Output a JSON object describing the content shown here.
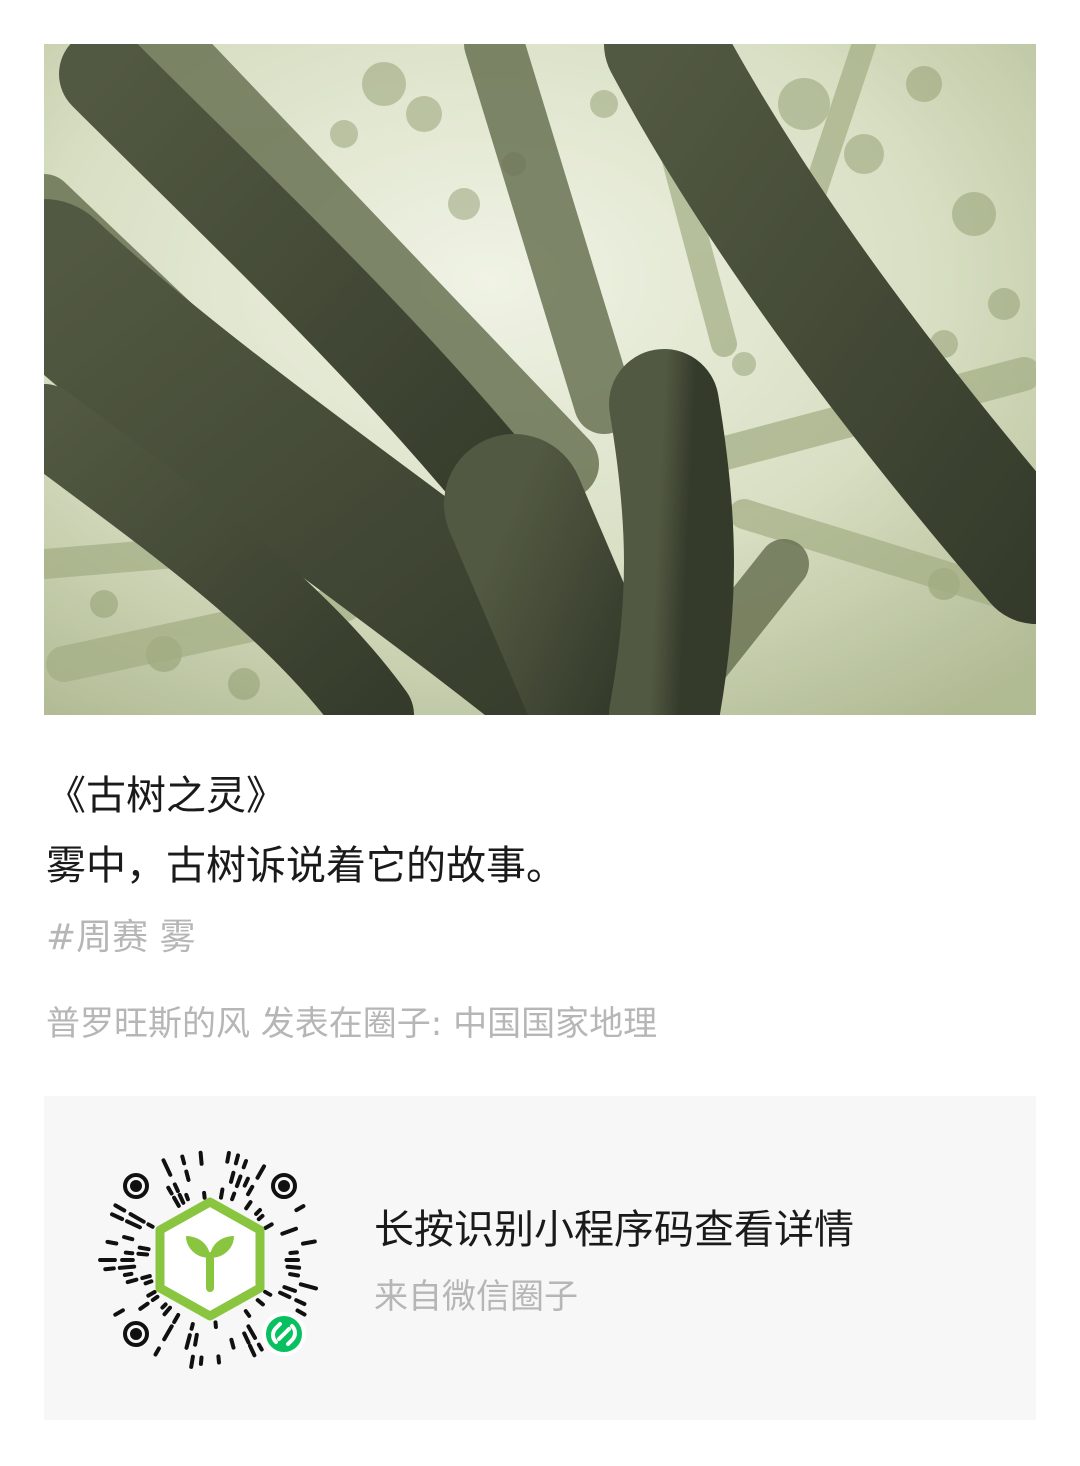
{
  "post": {
    "title": "《古树之灵》",
    "caption": "雾中，古树诉说着它的故事。",
    "tags": "#周赛 雾",
    "meta": "普罗旺斯的风 发表在圈子: 中国国家地理"
  },
  "mini_program_card": {
    "title": "长按识别小程序码查看详情",
    "subtitle": "来自微信圈子",
    "qr_code_icon": "sprout-in-hexagon-icon",
    "badge_icon": "mini-program-link-icon",
    "accent_color": "#8ac53f",
    "badge_color": "#07c160"
  },
  "photo": {
    "subject": "mossy-tree-branches-in-fog"
  }
}
